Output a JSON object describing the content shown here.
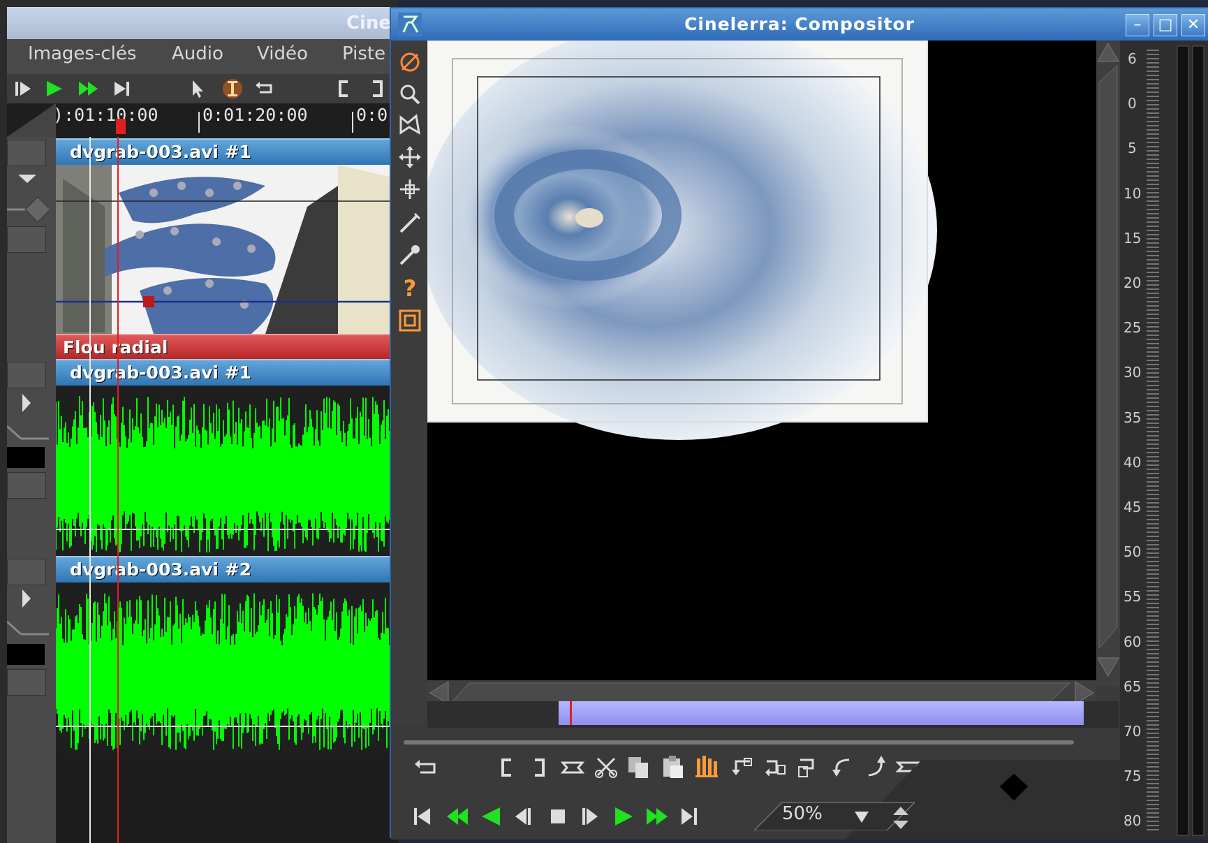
{
  "background_window": {
    "title": "Cine",
    "menu": [
      "Images-clés",
      "Audio",
      "Vidéo",
      "Piste"
    ],
    "ruler": [
      "):01:10:00",
      "0:01:20:00",
      "0:0"
    ],
    "tracks": {
      "video_track": "dvgrab-003.avi #1",
      "effect": "Flou radial",
      "audio_track_1": "dvgrab-003.avi #1",
      "audio_track_2": "dvgrab-003.avi #2"
    }
  },
  "compositor": {
    "title": "Cinelerra: Compositor",
    "window_buttons": [
      "minimize",
      "maximize",
      "close"
    ],
    "tools": [
      "protect-icon",
      "zoom-icon",
      "mask-icon",
      "ruler-move-icon",
      "projector-icon",
      "crop-icon",
      "eyedropper-icon",
      "help-icon",
      "safe-region-icon"
    ],
    "meter_labels": [
      "6",
      "0",
      "5",
      "10",
      "15",
      "20",
      "25",
      "30",
      "35",
      "40",
      "45",
      "50",
      "55",
      "60",
      "65",
      "70",
      "75",
      "80"
    ],
    "zoom": "50%",
    "edit_buttons": [
      "loop-icon",
      "in-point-icon",
      "out-point-icon",
      "label-icon",
      "cut-icon",
      "copy-icon",
      "paste-icon",
      "splice-icon",
      "overwrite-icon",
      "to-clip-icon",
      "undo-icon",
      "redo-icon",
      "prev-label-icon",
      "next-label-icon"
    ],
    "transport_buttons": [
      "rewind-icon",
      "fast-reverse-icon",
      "reverse-icon",
      "frame-back-icon",
      "stop-icon",
      "frame-forward-icon",
      "play-icon",
      "fast-forward-icon",
      "end-icon"
    ]
  },
  "colors": {
    "accent_green": "#00ff00",
    "title_blue": "#2f76b6",
    "effect_red": "#b32323",
    "playhead": "#e02020"
  }
}
